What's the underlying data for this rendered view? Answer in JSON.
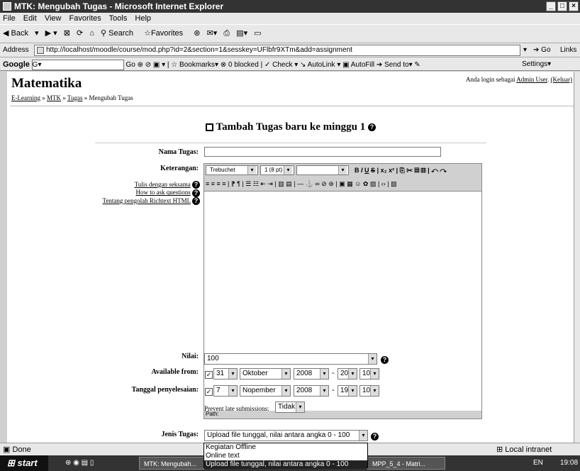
{
  "window": {
    "title": "MTK: Mengubah Tugas - Microsoft Internet Explorer"
  },
  "menu": [
    "File",
    "Edit",
    "View",
    "Favorites",
    "Tools",
    "Help"
  ],
  "toolbar": {
    "back": "Back",
    "search": "Search",
    "favorites": "Favorites"
  },
  "address": {
    "label": "Address",
    "url": "http://localhost/moodle/course/mod.php?id=2&section=1&sesskey=UFlbfr9XTm&add=assignment",
    "go": "Go",
    "links": "Links"
  },
  "google": {
    "label": "Google",
    "search_box": "G▾",
    "items": "Go ⊕ ⊘ ▣ ▾ | ☆ Bookmarks▾  ⊗ 0 blocked  | ✓ Check ▾  ↘ AutoLink ▾  ▣ AutoFill  ➔ Send to▾  ✎",
    "settings": "Settings▾"
  },
  "page": {
    "site_title": "Matematika",
    "login_prefix": "Anda login sebagai",
    "login_user": "Admin User",
    "login_logout": "(Keluar)",
    "breadcrumb": {
      "home": "E-Learning",
      "course": "MTK",
      "module": "Tugas",
      "current": "Mengubah Tugas",
      "sep": "»"
    },
    "form_title": "Tambah Tugas baru ke minggu 1"
  },
  "form": {
    "name_label": "Nama Tugas:",
    "name_value": "",
    "desc_label": "Keterangan:",
    "help_links": [
      "Tulis dengan seksama",
      "How to ask questions",
      "Tentang pengolah Richtext HTML"
    ],
    "editor": {
      "font": "Trebuchet",
      "size": "1 (8 pt)",
      "heading": "",
      "path": "Path:"
    },
    "grade_label": "Nilai:",
    "grade_value": "100",
    "available_label": "Available from:",
    "available": {
      "day": "31",
      "month": "Oktober",
      "year": "2008",
      "hour": "20",
      "minute": "10"
    },
    "due_label": "Tanggal penyelesaian:",
    "due": {
      "day": "7",
      "month": "Nopember",
      "year": "2008",
      "hour": "19",
      "minute": "10"
    },
    "date_sep": "-",
    "late_label": "Prevent late submissions:",
    "late_value": "Tidak",
    "type_label": "Jenis Tugas:",
    "type_value": "Upload file tunggal, nilai antara angka 0 - 100",
    "type_options": [
      "Kegiatan Offline",
      "Online text",
      "Upload file tunggal, nilai antara angka 0 - 100"
    ]
  },
  "status": {
    "text": "Done",
    "zone": "Local intranet"
  },
  "taskbar": {
    "start": "start",
    "task1": "MTK: Mengubah...",
    "task2": "MPP_5_4 - Matri...",
    "clock": "19:08",
    "lang": "EN"
  }
}
